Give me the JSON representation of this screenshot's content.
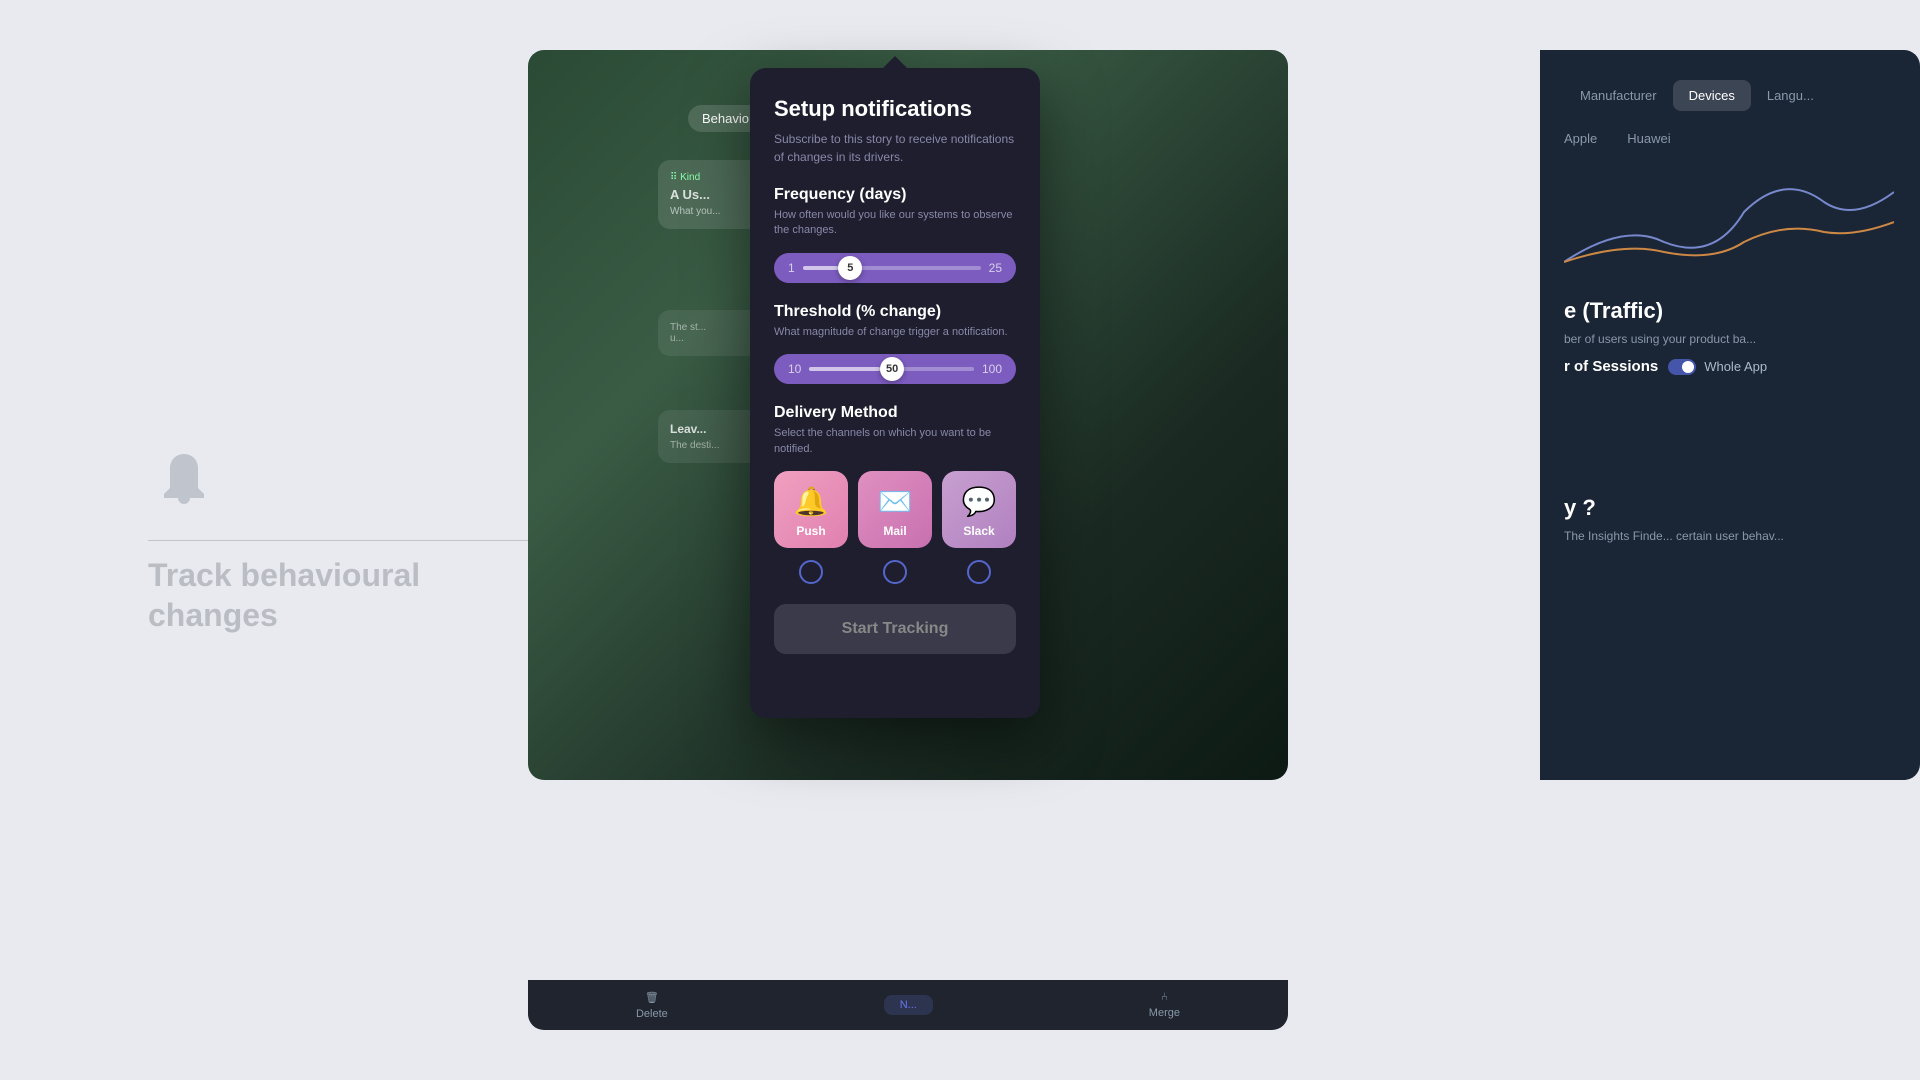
{
  "left_panel": {
    "bell_icon": "🔔",
    "track_title": "Track behavioural\nchanges"
  },
  "modal": {
    "title": "Setup notifications",
    "subtitle": "Subscribe to this story to receive notifications of changes in its drivers.",
    "frequency": {
      "title": "Frequency (days)",
      "desc": "How often would you like our systems to observe the changes.",
      "min": "1",
      "max": "25",
      "value": "5",
      "fill_percent": 20
    },
    "threshold": {
      "title": "Threshold (% change)",
      "desc": "What magnitude of change trigger a notification.",
      "min": "10",
      "max": "100",
      "value": "50",
      "fill_percent": 43
    },
    "delivery": {
      "title": "Delivery Method",
      "desc": "Select the channels on which you want to be notified.",
      "channels": [
        {
          "id": "push",
          "label": "Push",
          "icon": "🔔",
          "class": "push"
        },
        {
          "id": "mail",
          "label": "Mail",
          "icon": "✉️",
          "class": "mail"
        },
        {
          "id": "slack",
          "label": "Slack",
          "icon": "💬",
          "class": "slack"
        }
      ]
    },
    "start_tracking_label": "Start Tracking"
  },
  "app_bg": {
    "behavior_pill": "Behavio...",
    "kind_label": "Kind",
    "card1_title": "A Us...",
    "card1_desc": "What you...",
    "card2_desc": "The st...",
    "card2_desc2": "u...",
    "leave_label": "Leav...",
    "leave_desc": "The desti..."
  },
  "right_panel": {
    "filter_tabs": [
      "Manufacturer",
      "Devices",
      "Langu..."
    ],
    "active_tab": "Devices",
    "manufacturer_labels": [
      "Apple",
      "Huawei"
    ],
    "section_title": "e (Traffic)",
    "section_desc": "ber of users using your product ba...",
    "sessions_label": "r of Sessions",
    "whole_app_label": "Whole App",
    "insights_text": "y ?",
    "insights_desc": "The Insights Finde... certain user behav..."
  },
  "bottom_bar": {
    "items": [
      {
        "label": "Delete",
        "icon": "🗑"
      },
      {
        "label": "N...",
        "active": true
      },
      {
        "label": "Merge",
        "icon": "⑃"
      }
    ]
  }
}
